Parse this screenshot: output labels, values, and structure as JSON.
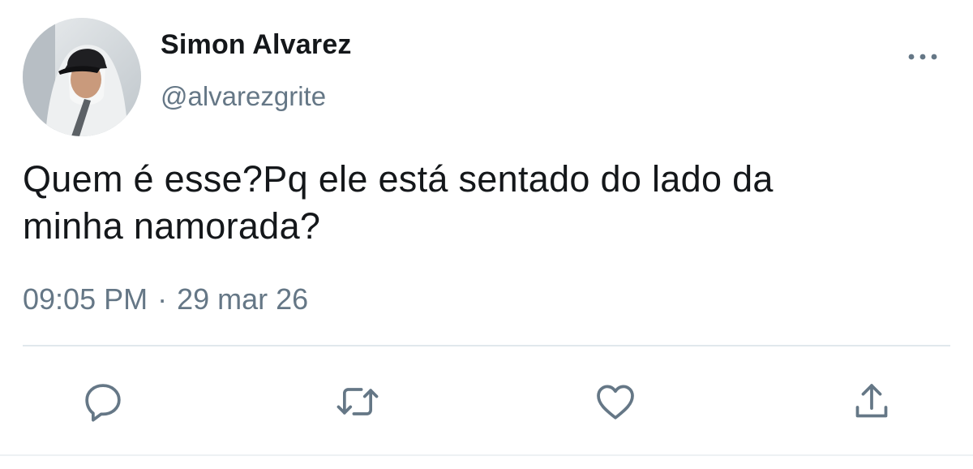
{
  "user": {
    "display_name": "Simon Alvarez",
    "handle": "@alvarezgrite",
    "avatar_icon": "profile-photo"
  },
  "tweet": {
    "text_line1": "Quem é esse?Pq ele está sentado do lado da",
    "text_line2": "minha namorada?",
    "time": "09:05 PM",
    "separator": "·",
    "date": "29 mar 26"
  },
  "menu": {
    "more_icon": "more-options-icon"
  },
  "actions": {
    "reply_icon": "reply-icon",
    "retweet_icon": "retweet-icon",
    "like_icon": "heart-icon",
    "share_icon": "share-icon"
  },
  "colors": {
    "primary_text": "#14171a",
    "secondary_text": "#657786",
    "icon": "#657786",
    "divider": "#e1e8ed"
  }
}
